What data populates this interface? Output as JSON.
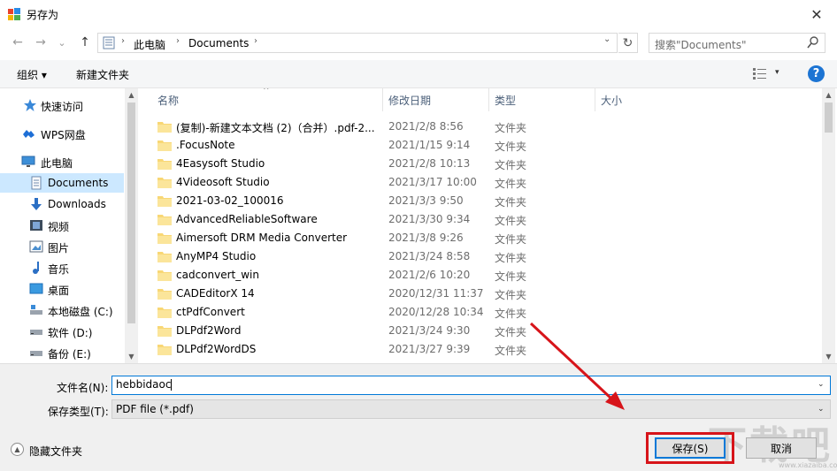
{
  "window": {
    "title": "另存为",
    "close_glyph": "✕"
  },
  "nav": {
    "back": "←",
    "forward": "→",
    "recent": "⌄",
    "up": "↑"
  },
  "address": {
    "crumbs": [
      "此电脑",
      "Documents"
    ],
    "separator": "›",
    "refresh_glyph": "↻",
    "dropdown_glyph": "⌄"
  },
  "search": {
    "placeholder": "搜索\"Documents\""
  },
  "toolbar": {
    "organize": "组织 ▾",
    "new_folder": "新建文件夹",
    "view_drop": "▾",
    "help": "?"
  },
  "sidebar": {
    "items": [
      {
        "label": "快速访问",
        "icon": "star-icon"
      },
      {
        "label": "WPS网盘",
        "icon": "cloud-icon"
      },
      {
        "label": "此电脑",
        "icon": "computer-icon"
      },
      {
        "label": "Documents",
        "icon": "document-icon",
        "selected": true
      },
      {
        "label": "Downloads",
        "icon": "download-icon"
      },
      {
        "label": "视频",
        "icon": "video-icon"
      },
      {
        "label": "图片",
        "icon": "picture-icon"
      },
      {
        "label": "音乐",
        "icon": "music-icon"
      },
      {
        "label": "桌面",
        "icon": "desktop-icon"
      },
      {
        "label": "本地磁盘 (C:)",
        "icon": "drive-c-icon"
      },
      {
        "label": "软件 (D:)",
        "icon": "drive-icon"
      },
      {
        "label": "备份 (E:)",
        "icon": "drive-icon"
      }
    ],
    "scroll_up": "▲",
    "scroll_down": "▼"
  },
  "columns": {
    "name": "名称",
    "date": "修改日期",
    "type": "类型",
    "size": "大小",
    "sort_caret": "^"
  },
  "files": [
    {
      "name": "(复制)-新建文本文档 (2)（合并）.pdf-2...",
      "date": "2021/2/8 8:56",
      "type": "文件夹"
    },
    {
      "name": ".FocusNote",
      "date": "2021/1/15 9:14",
      "type": "文件夹"
    },
    {
      "name": "4Easysoft Studio",
      "date": "2021/2/8 10:13",
      "type": "文件夹"
    },
    {
      "name": "4Videosoft Studio",
      "date": "2021/3/17 10:00",
      "type": "文件夹"
    },
    {
      "name": "2021-03-02_100016",
      "date": "2021/3/3 9:50",
      "type": "文件夹"
    },
    {
      "name": "AdvancedReliableSoftware",
      "date": "2021/3/30 9:34",
      "type": "文件夹"
    },
    {
      "name": "Aimersoft DRM Media Converter",
      "date": "2021/3/8 9:26",
      "type": "文件夹"
    },
    {
      "name": "AnyMP4 Studio",
      "date": "2021/3/24 8:58",
      "type": "文件夹"
    },
    {
      "name": "cadconvert_win",
      "date": "2021/2/6 10:20",
      "type": "文件夹"
    },
    {
      "name": "CADEditorX 14",
      "date": "2020/12/31 11:37",
      "type": "文件夹"
    },
    {
      "name": "ctPdfConvert",
      "date": "2020/12/28 10:34",
      "type": "文件夹"
    },
    {
      "name": "DLPdf2Word",
      "date": "2021/3/24 9:30",
      "type": "文件夹"
    },
    {
      "name": "DLPdf2WordDS",
      "date": "2021/3/27 9:39",
      "type": "文件夹"
    }
  ],
  "form": {
    "filename_label": "文件名(N):",
    "filename_value": "hebbidaoc",
    "filetype_label": "保存类型(T):",
    "filetype_value": "PDF file (*.pdf)",
    "drop_glyph": "⌄"
  },
  "footer": {
    "hide_folders": "隐藏文件夹",
    "hide_glyph": "▲",
    "save": "保存(S)",
    "cancel": "取消"
  },
  "watermark": {
    "text": "下载吧",
    "url": "www.xiazaiba.com"
  },
  "colors": {
    "accent": "#0078d7",
    "selection": "#cce8ff",
    "annotation_red": "#d7141a",
    "folder_yellow": "#f8d775"
  }
}
